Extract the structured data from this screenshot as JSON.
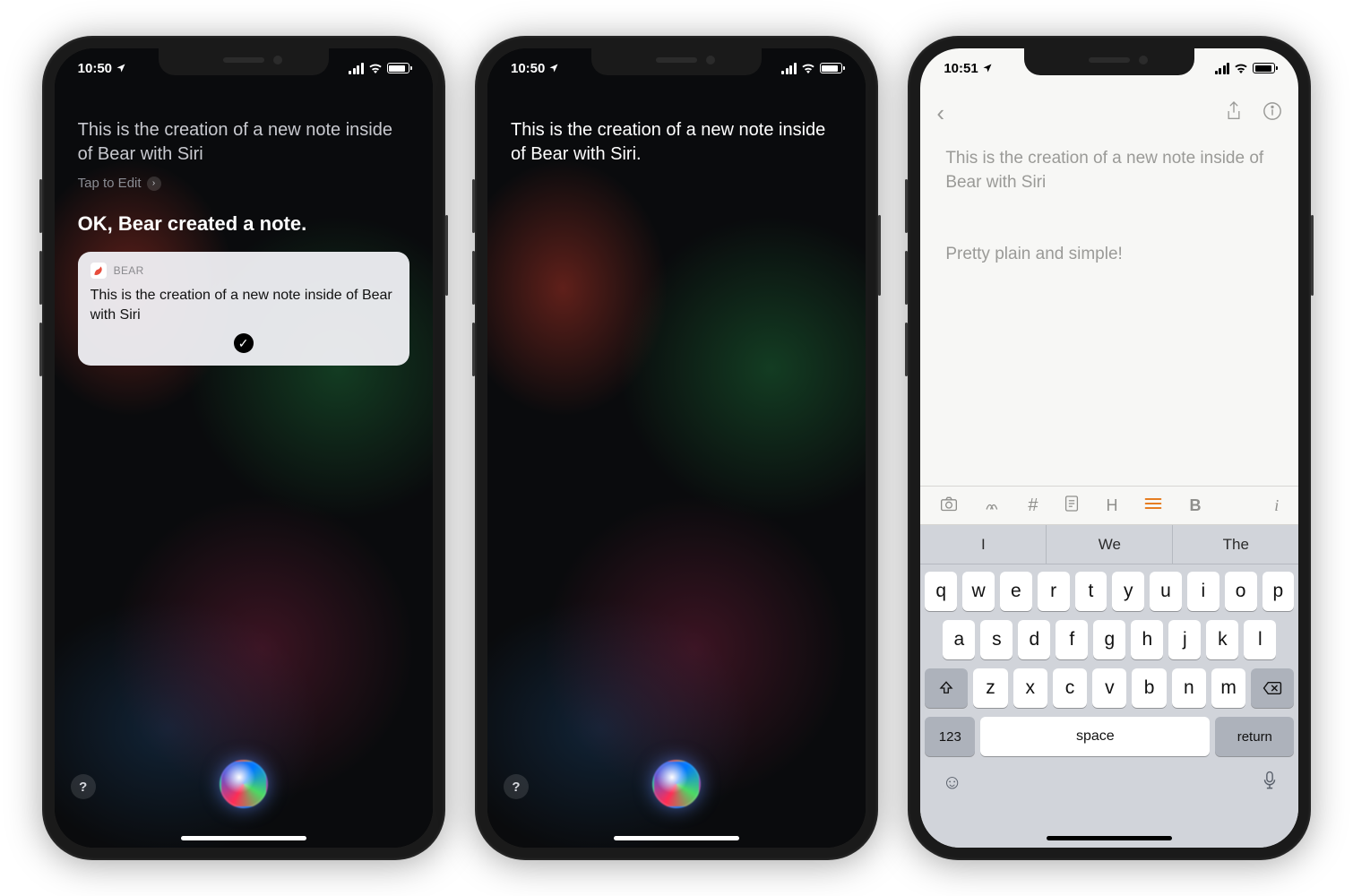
{
  "phone1": {
    "time": "10:50",
    "query": "This is the creation of a new note inside of Bear with Siri",
    "tap_to_edit": "Tap to Edit",
    "response": "OK, Bear created a note.",
    "card": {
      "app": "BEAR",
      "text": "This is the creation of a new note inside of Bear with Siri"
    }
  },
  "phone2": {
    "time": "10:50",
    "query": "This is the creation of a new note inside of Bear with Siri."
  },
  "phone3": {
    "time": "10:51",
    "title": "This is the creation of a new note inside of Bear with Siri",
    "body": "Pretty plain and simple!",
    "toolbar": {
      "h": "H",
      "b": "B",
      "i": "i"
    },
    "suggestions": [
      "I",
      "We",
      "The"
    ],
    "keyboard": {
      "row1": [
        "q",
        "w",
        "e",
        "r",
        "t",
        "y",
        "u",
        "i",
        "o",
        "p"
      ],
      "row2": [
        "a",
        "s",
        "d",
        "f",
        "g",
        "h",
        "j",
        "k",
        "l"
      ],
      "row3": [
        "z",
        "x",
        "c",
        "v",
        "b",
        "n",
        "m"
      ],
      "num": "123",
      "space": "space",
      "return": "return"
    }
  },
  "help": "?"
}
